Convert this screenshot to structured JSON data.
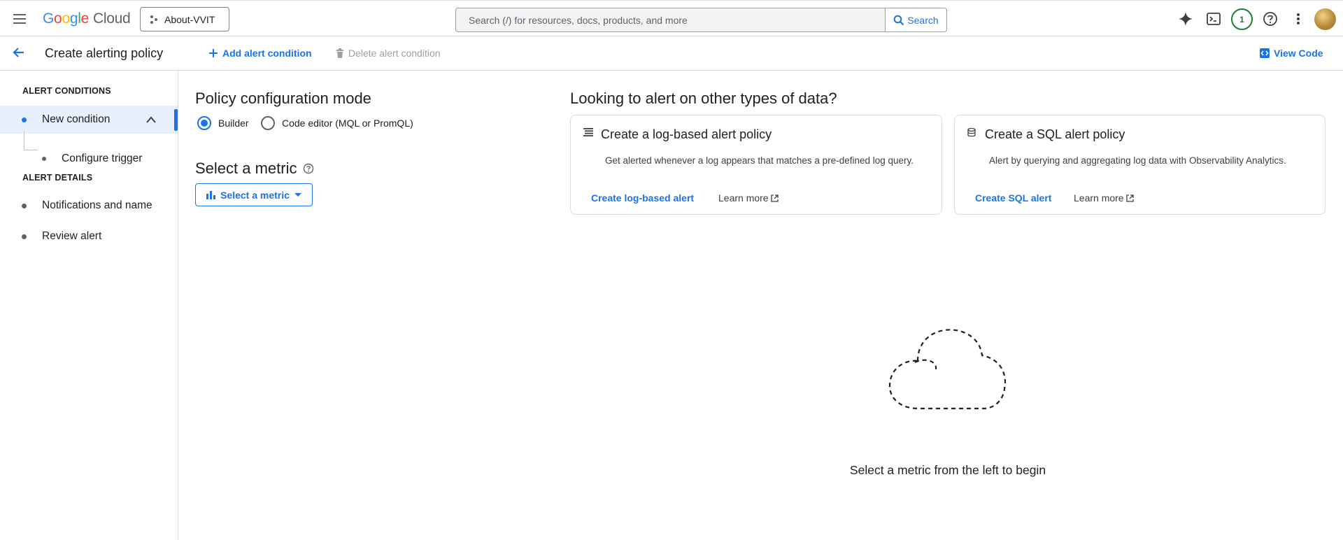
{
  "header": {
    "logo_letters": [
      "G",
      "o",
      "o",
      "g",
      "l",
      "e"
    ],
    "logo_product": "Cloud",
    "project": "About-VVIT",
    "search_placeholder": "Search (/) for resources, docs, products, and more",
    "search_button": "Search",
    "notifications_count": "1"
  },
  "toolbar": {
    "page_title": "Create alerting policy",
    "add_condition": "Add alert condition",
    "delete_condition": "Delete alert condition",
    "view_code": "View Code"
  },
  "sidebar": {
    "section_conditions": "ALERT CONDITIONS",
    "new_condition": "New condition",
    "configure_trigger": "Configure trigger",
    "section_details": "ALERT DETAILS",
    "notifications_name": "Notifications and name",
    "review_alert": "Review alert"
  },
  "main": {
    "config_mode_title": "Policy configuration mode",
    "mode_builder": "Builder",
    "mode_code_editor": "Code editor (MQL or PromQL)",
    "select_metric_title": "Select a metric",
    "select_metric_button": "Select a metric",
    "other_types_title": "Looking to alert on other types of data?",
    "log_card": {
      "title": "Create a log-based alert policy",
      "description": "Get alerted whenever a log appears that matches a pre-defined log query.",
      "link": "Create log-based alert",
      "learn_more": "Learn more"
    },
    "sql_card": {
      "title": "Create a SQL alert policy",
      "description": "Alert by querying and aggregating log data with Observability Analytics.",
      "link": "Create SQL alert",
      "learn_more": "Learn more"
    },
    "empty_state_text": "Select a metric from the left to begin"
  },
  "colors": {
    "accent": "#1a73e8",
    "notification_ring": "#188038",
    "disabled": "#9aa0a6"
  }
}
